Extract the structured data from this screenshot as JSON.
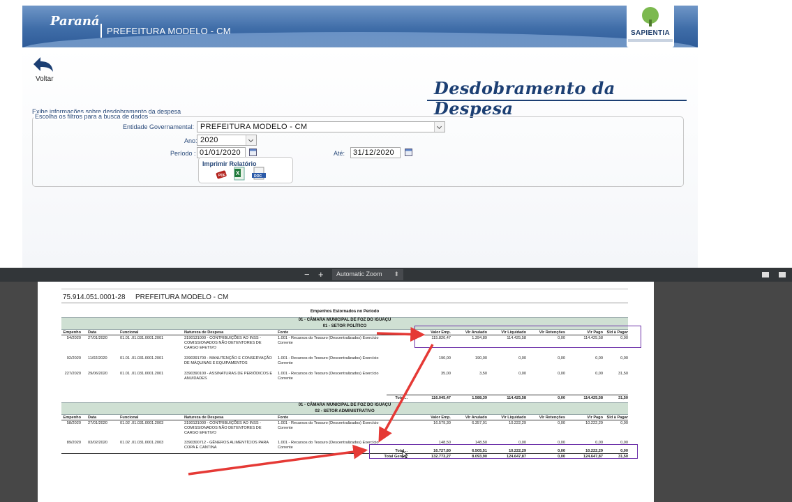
{
  "app": {
    "brand": "Paraná",
    "entity": "PREFEITURA MODELO - CM",
    "logo_text": "SAPIENTIA",
    "back_label": "Voltar",
    "page_title": "Desdobramento da Despesa",
    "info_text": "Exibe informações sobre desdobramento da despesa",
    "filters_legend": "Escolha os filtros para a busca de dados",
    "filters": {
      "entidade_label": "Entidade Governamental:",
      "entidade_value": "PREFEITURA MODELO - CM",
      "ano_label": "Ano:",
      "ano_value": "2020",
      "periodo_label": "Período :",
      "periodo_value": "01/01/2020",
      "ate_label": "Até:",
      "ate_value": "31/12/2020"
    },
    "print_label": "Imprimir Relatório",
    "print_icons": [
      "pdf-icon",
      "excel-icon",
      "doc-icon"
    ]
  },
  "viewer": {
    "minus": "−",
    "plus": "+",
    "zoom": "Automatic Zoom"
  },
  "report": {
    "cnpj": "75.914.051.0001-28",
    "entity": "PREFEITURA MODELO - CM",
    "title": "Empenhos Estornados no Período",
    "columns": [
      "Empenho",
      "Data",
      "Funcional",
      "Natureza de Despesa",
      "Fonte",
      "Valor Emp.",
      "Vlr Anulado",
      "Vlr Liquidado",
      "Vlr Retenções",
      "Vlr Pago",
      "Sld à Pagar"
    ],
    "groups": [
      {
        "orgao": "01 - CÂMARA MUNICIPAL DE FOZ DO IGUAÇU",
        "setor": "01 - SETOR POLÍTICO",
        "rows": [
          {
            "empenho": "54/2020",
            "data": "27/01/2020",
            "funcional": "01.01 .01.031.0001.2001",
            "natureza": "3190131000 - CONTRIBUIÇÕES AO INSS - COMISSIONADOS NÃO DETENTORES DE CARGO EFETIVO",
            "fonte": "1.001 - Recursos do Tesouro (Descentralizados) Exercício Corrente",
            "valor": "115.820,47",
            "anulado": "1.394,89",
            "liquidado": "114.425,58",
            "retencoes": "0,00",
            "pago": "114.425,58",
            "saldo": "0,00"
          },
          {
            "empenho": "92/2020",
            "data": "11/02/2020",
            "funcional": "01.01 .01.031.0001.2001",
            "natureza": "3390391700 - MANUTENÇÃO E CONSERVAÇÃO DE MÁQUINAS E EQUIPAMENTOS",
            "fonte": "1.001 - Recursos do Tesouro (Descentralizados) Exercício Corrente",
            "valor": "190,00",
            "anulado": "190,00",
            "liquidado": "0,00",
            "retencoes": "0,00",
            "pago": "0,00",
            "saldo": "0,00"
          },
          {
            "empenho": "227/2020",
            "data": "29/06/2020",
            "funcional": "01.01 .01.031.0001.2001",
            "natureza": "3390390100 - ASSINATURAS DE PERIÓDICOS E ANUIDADES",
            "fonte": "1.001 - Recursos do Tesouro (Descentralizados) Exercício Corrente",
            "valor": "35,00",
            "anulado": "3,50",
            "liquidado": "0,00",
            "retencoes": "0,00",
            "pago": "0,00",
            "saldo": "31,50"
          }
        ],
        "total_label": "Total...",
        "total": {
          "valor": "116.045,47",
          "anulado": "1.588,39",
          "liquidado": "114.425,58",
          "retencoes": "0,00",
          "pago": "114.425,58",
          "saldo": "31,50"
        }
      },
      {
        "orgao": "01 - CÂMARA MUNICIPAL DE FOZ DO IGUAÇU",
        "setor": "02 - SETOR ADMINISTRATIVO",
        "rows": [
          {
            "empenho": "58/2020",
            "data": "27/01/2020",
            "funcional": "01.02 .01.031.0001.2003",
            "natureza": "3190131000 - CONTRIBUIÇÕES AO INSS - COMISSIONADOS NÃO DETENTORES DE CARGO EFETIVO",
            "fonte": "1.001 - Recursos do Tesouro (Descentralizados) Exercício Corrente",
            "valor": "16.579,30",
            "anulado": "6.357,01",
            "liquidado": "10.222,29",
            "retencoes": "0,00",
            "pago": "10.222,29",
            "saldo": "0,00"
          },
          {
            "empenho": "89/2020",
            "data": "03/02/2020",
            "funcional": "01.02 .01.031.0001.2003",
            "natureza": "3390300712 - GÊNEROS ALIMENTÍCIOS PARA COPA E CANTINA",
            "fonte": "1.001 - Recursos do Tesouro (Descentralizados) Exercício Corrente",
            "valor": "148,50",
            "anulado": "148,50",
            "liquidado": "0,00",
            "retencoes": "0,00",
            "pago": "0,00",
            "saldo": "0,00"
          }
        ],
        "total_label": "Total...",
        "total": {
          "valor": "16.727,80",
          "anulado": "6.505,51",
          "liquidado": "10.222,29",
          "retencoes": "0,00",
          "pago": "10.222,29",
          "saldo": "0,00"
        }
      }
    ],
    "grand_total_label": "Total Geral...",
    "grand_total": {
      "valor": "132.773,27",
      "anulado": "8.093,90",
      "liquidado": "124.647,87",
      "retencoes": "0,00",
      "pago": "124.647,87",
      "saldo": "31,50"
    }
  },
  "colors": {
    "header_blue": "#3f6da8",
    "title_blue": "#1c3f73",
    "highlight_purple": "#6b2fa8",
    "arrow_red": "#e53935",
    "band_green": "#cfe0d3"
  }
}
